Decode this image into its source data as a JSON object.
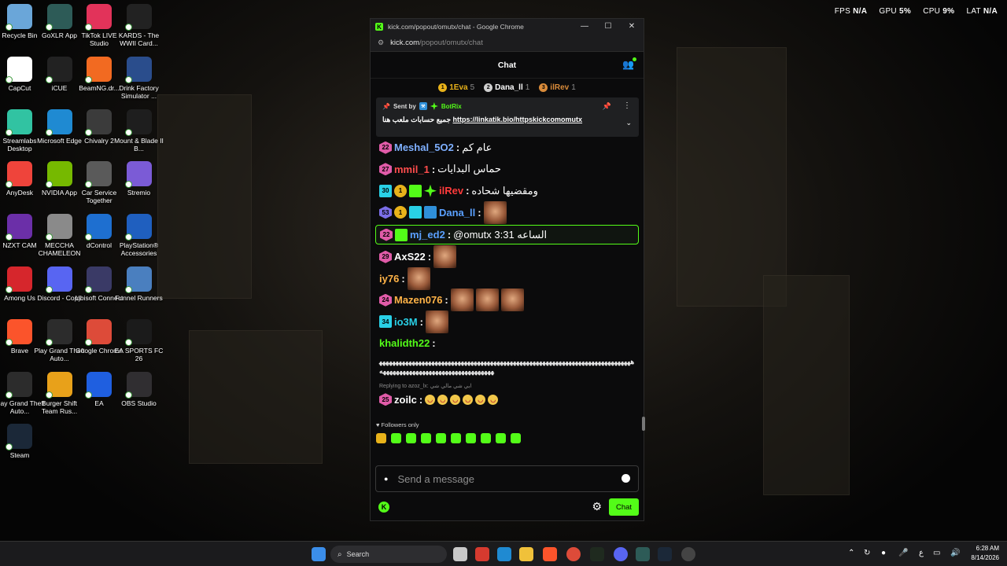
{
  "perf": {
    "fps_label": "FPS",
    "fps": "N/A",
    "gpu_label": "GPU",
    "gpu": "5%",
    "cpu_label": "CPU",
    "cpu": "9%",
    "lat_label": "LAT",
    "lat": "N/A"
  },
  "desktop_icons": [
    {
      "label": "Recycle Bin",
      "icon": "recycle-bin-icon",
      "color": "#6aa6d9"
    },
    {
      "label": "GoXLR App",
      "icon": "goxlr-icon",
      "color": "#2d5b57"
    },
    {
      "label": "TikTok LIVE Studio",
      "icon": "tiktok-icon",
      "color": "#e2335a"
    },
    {
      "label": "KARDS - The WWII Card...",
      "icon": "kards-icon",
      "color": "#222222"
    },
    {
      "label": "CapCut",
      "icon": "capcut-icon",
      "color": "#ffffff"
    },
    {
      "label": "iCUE",
      "icon": "icue-icon",
      "color": "#222222"
    },
    {
      "label": "BeamNG.dr...",
      "icon": "beamng-icon",
      "color": "#f26a21"
    },
    {
      "label": "Drink Factory Simulator ...",
      "icon": "drink-factory-icon",
      "color": "#2a4d8c"
    },
    {
      "label": "Streamlabs Desktop",
      "icon": "streamlabs-icon",
      "color": "#31c3a2"
    },
    {
      "label": "Microsoft Edge",
      "icon": "edge-icon",
      "color": "#1f8ad2"
    },
    {
      "label": "Chivalry 2",
      "icon": "chivalry-icon",
      "color": "#3b3b3b"
    },
    {
      "label": "Mount & Blade II B...",
      "icon": "bannerlord-icon",
      "color": "#1e1e1e"
    },
    {
      "label": "AnyDesk",
      "icon": "anydesk-icon",
      "color": "#ef443b"
    },
    {
      "label": "NVIDIA App",
      "icon": "nvidia-icon",
      "color": "#76b900"
    },
    {
      "label": "Car Service Together",
      "icon": "car-service-icon",
      "color": "#5a5a5a"
    },
    {
      "label": "Stremio",
      "icon": "stremio-icon",
      "color": "#7b5bd6"
    },
    {
      "label": "NZXT CAM",
      "icon": "nzxt-icon",
      "color": "#6b2fa8"
    },
    {
      "label": "MECCHA CHAMELEON",
      "icon": "meccha-icon",
      "color": "#8a8a8a"
    },
    {
      "label": "dControl",
      "icon": "dcontrol-icon",
      "color": "#1e6fd0"
    },
    {
      "label": "PlayStation® Accessories",
      "icon": "playstation-icon",
      "color": "#1f5fbf"
    },
    {
      "label": "Among Us",
      "icon": "among-us-icon",
      "color": "#d6262c"
    },
    {
      "label": "Discord - Copy",
      "icon": "discord-icon",
      "color": "#5865f2"
    },
    {
      "label": "Ubisoft Connect",
      "icon": "ubisoft-icon",
      "color": "#3a3a66"
    },
    {
      "label": "Funnel Runners",
      "icon": "funnel-runners-icon",
      "color": "#4a7fbf"
    },
    {
      "label": "Brave",
      "icon": "brave-icon",
      "color": "#fb542b"
    },
    {
      "label": "Play Grand Theft Auto...",
      "icon": "gta-icon",
      "color": "#2c2c2c"
    },
    {
      "label": "Google Chrome",
      "icon": "chrome-icon",
      "color": "#dd4b39"
    },
    {
      "label": "EA SPORTS FC 26",
      "icon": "fc26-icon",
      "color": "#1b1b1b"
    },
    {
      "label": "Play Grand Theft Auto...",
      "icon": "gta-icon",
      "color": "#2c2c2c"
    },
    {
      "label": "Burger Shift Team Rus...",
      "icon": "burger-shift-icon",
      "color": "#e8a11a"
    },
    {
      "label": "EA",
      "icon": "ea-icon",
      "color": "#1f5fe0"
    },
    {
      "label": "OBS Studio",
      "icon": "obs-icon",
      "color": "#302e31"
    },
    {
      "label": "Steam",
      "icon": "steam-icon",
      "color": "#1b2838"
    }
  ],
  "window": {
    "title": "kick.com/popout/omutx/chat - Google Chrome",
    "url_host": "kick.com",
    "url_path": "/popout/omutx/chat",
    "minimize": "—",
    "maximize": "☐",
    "close": "✕"
  },
  "chat": {
    "header": "Chat",
    "leaders": [
      {
        "rank": "1",
        "name": "1Eva",
        "count": "5",
        "color": "#e8b21a"
      },
      {
        "rank": "2",
        "name": "Dana_ll",
        "count": "1",
        "color": "#cfcfcf"
      },
      {
        "rank": "3",
        "name": "ilRev",
        "count": "1",
        "color": "#d98b3a"
      }
    ],
    "pinned": {
      "sent_by": "Sent by",
      "bot_name": "BotRix",
      "message_ar": "جميع حسابات ملعب هنا",
      "link": "https://linkatik.bio/httpskickcomomutx"
    },
    "messages": [
      {
        "badge": "22",
        "user": "Meshal_5O2",
        "color": "#7fb0ff",
        "text": "عام كم"
      },
      {
        "badge": "27",
        "user": "mmil_1",
        "color": "#ff4d4d",
        "text": "حماس البدايات"
      },
      {
        "badge": "30",
        "user": "ilRev",
        "color": "#ff3b3b",
        "text": "ومقضيها شحاده"
      },
      {
        "badge": "53",
        "user": "Dana_ll",
        "color": "#5aa0ff",
        "text": ""
      },
      {
        "badge": "22",
        "user": "mj_ed2",
        "color": "#5aa0ff",
        "text": "@omutx 3:31 الساعه"
      },
      {
        "badge": "29",
        "user": "AxS22",
        "color": "#ffffff",
        "text": ""
      },
      {
        "badge": "",
        "user": "iy76",
        "color": "#ffb347",
        "text": ""
      },
      {
        "badge": "24",
        "user": "Mazen076",
        "color": "#ffb347",
        "text": ""
      },
      {
        "badge": "34",
        "user": "io3M",
        "color": "#29d0e6",
        "text": ""
      },
      {
        "badge": "",
        "user": "khalidth22",
        "color": "#53fc18",
        "text": "ههههههههههههههههههههههههههههههههههههههههههههههههههههههههههههههههههههههههههههههههههههههههههههههههههههههههههههههههه"
      },
      {
        "badge": "25",
        "user": "zoilc",
        "color": "#ffffff",
        "text": ""
      }
    ],
    "reply_text": "Replying to azoz_lx: ابي شي مالي شي",
    "followers_only": "Followers only",
    "input_placeholder": "Send a message",
    "send_label": "Chat"
  },
  "taskbar": {
    "search_placeholder": "Search",
    "time": "6:28 AM",
    "date": "8/14/2026",
    "lang": "ع"
  }
}
